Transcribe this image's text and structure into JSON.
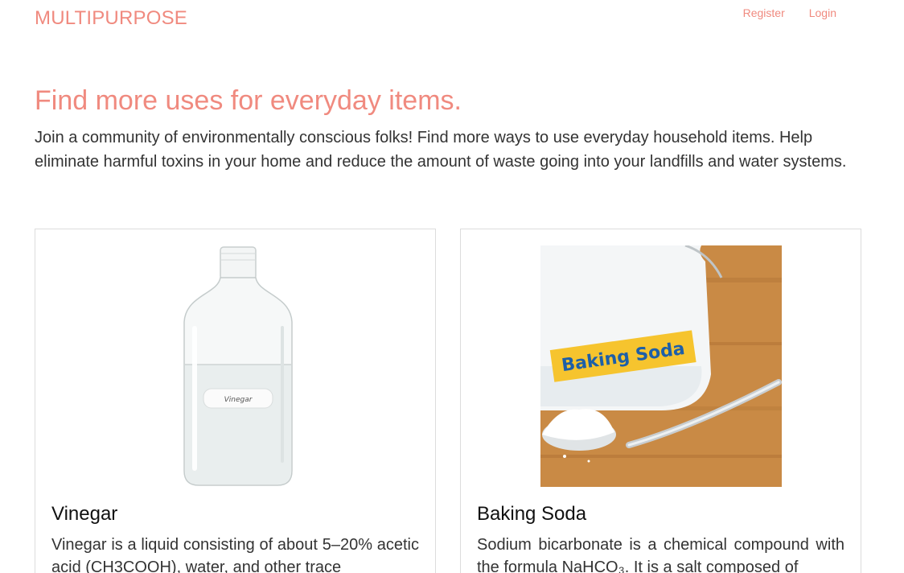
{
  "header": {
    "brand": "MULTIPURPOSE",
    "nav": [
      {
        "label": "Register"
      },
      {
        "label": "Login"
      }
    ]
  },
  "hero": {
    "title": "Find more uses for everyday items.",
    "text": "Join a community of environmentally conscious folks! Find more ways to use everyday household items. Help eliminate harmful toxins in your home and reduce the amount of waste going into your landfills and water systems."
  },
  "cards": [
    {
      "title": "Vinegar",
      "text": "Vinegar is a liquid consisting of about 5–20% acetic acid (CH3COOH), water, and other trace",
      "image_label": "Vinegar"
    },
    {
      "title": "Baking Soda",
      "text": "Sodium bicarbonate is a chemical compound with the formula NaHCO₃. It is a salt composed of",
      "image_label": "Baking Soda"
    }
  ],
  "colors": {
    "accent": "#f08a7f",
    "text": "#333333",
    "card_border": "#dcdcdc"
  }
}
